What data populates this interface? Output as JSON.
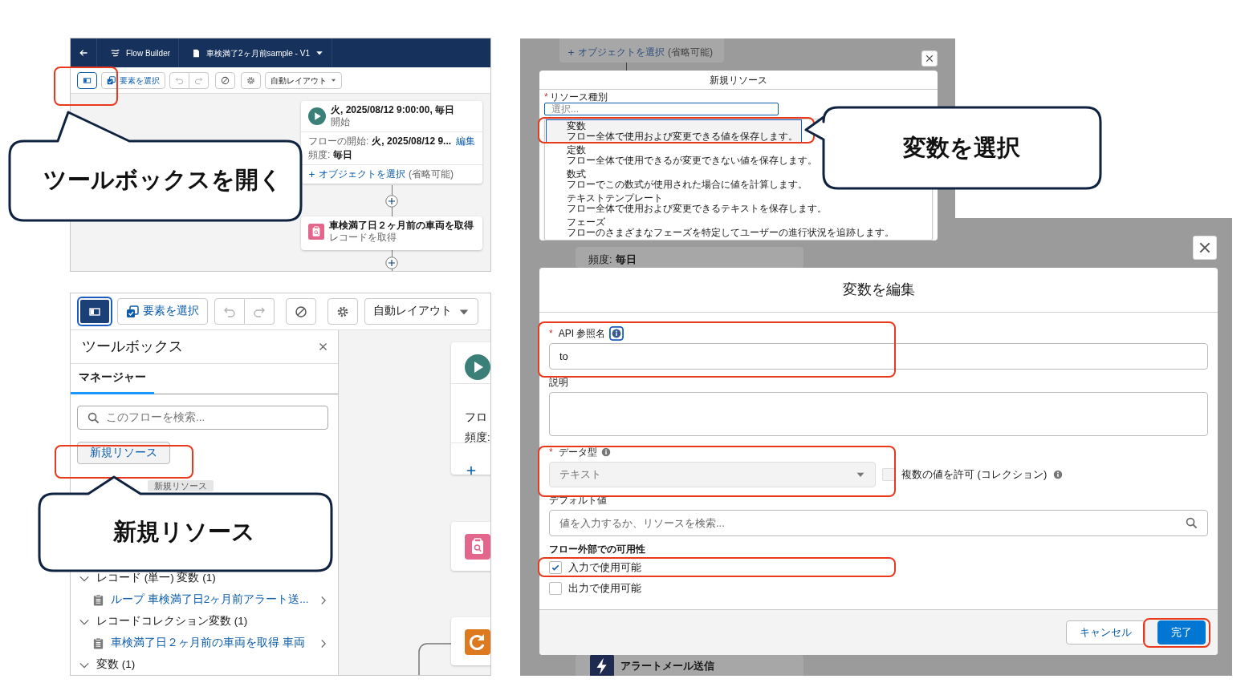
{
  "flow_builder_screen": {
    "header": {
      "app_name": "Flow Builder",
      "flow_title": "車検満了2ヶ月前sample - V1"
    },
    "toolbar": {
      "toolbox_open": false,
      "select_label": "要素を選択",
      "layout_label": "自動レイアウト"
    },
    "start_node": {
      "title": "火, 2025/08/12 9:00:00, 毎日",
      "subtitle": "開始",
      "start_label": "フローの開始:",
      "start_value": "火, 2025/08/12 9...",
      "edit_link": "編集",
      "frequency_label": "頻度:",
      "frequency_value": "毎日",
      "object_link": "オブジェクトを選択",
      "object_hint": "(省略可能)"
    },
    "get_records_node": {
      "title": "車検満了日２ヶ月前の車両を取得",
      "subtitle": "レコードを取得"
    }
  },
  "toolbox_screen": {
    "toolbar": {
      "toolbox_open": true,
      "select_label": "要素を選択",
      "layout_label": "自動レイアウト"
    },
    "toolbox": {
      "title": "ツールボックス",
      "tabs": [
        {
          "label": "マネージャー",
          "selected": true
        }
      ],
      "search_placeholder": "このフローを検索...",
      "new_resource_button": "新規リソース",
      "tooltip": "新規リソース",
      "tree": [
        {
          "label": "レコード (単一) 変数 (1)",
          "expanded": true,
          "children": [
            {
              "label": "ループ 車検満了日2ヶ月前アラート送..."
            }
          ]
        },
        {
          "label": "レコードコレクション変数 (1)",
          "expanded": true,
          "children": [
            {
              "label": "車検満了日２ヶ月前の車両を取得 車両"
            }
          ]
        },
        {
          "label": "変数 (1)",
          "expanded": true
        }
      ]
    },
    "canvas": {
      "start_node_text": "フロ",
      "frequency_label": "頻度:"
    }
  },
  "resource_type_screen": {
    "background": {
      "object_link": "オブジェクトを選択",
      "object_hint": "(省略可能)"
    },
    "modal": {
      "title": "新規リソース",
      "field_label": "リソース種別",
      "required_mark": "*",
      "placeholder": "選択...",
      "options": [
        {
          "label": "変数",
          "description": "フロー全体で使用および変更できる値を保存します。",
          "selected": true
        },
        {
          "label": "定数",
          "description": "フロー全体で使用できるが変更できない値を保存します。",
          "selected": false
        },
        {
          "label": "数式",
          "description": "フローでこの数式が使用された場合に値を計算します。",
          "selected": false
        },
        {
          "label": "テキストテンプレート",
          "description": "フロー全体で使用および変更できるテキストを保存します。",
          "selected": false
        },
        {
          "label": "フェーズ",
          "description": "フローのさまざまなフェーズを特定してユーザーの進行状況を追跡します。",
          "selected": false
        }
      ]
    }
  },
  "edit_variable_screen": {
    "background": {
      "frequency_label": "頻度:",
      "frequency_value": "毎日",
      "action_node": "アラートメール送信"
    },
    "modal": {
      "title": "変数を編集",
      "api_name": {
        "label": "API 参照名",
        "required_mark": "*",
        "value": "to"
      },
      "description": {
        "label": "説明"
      },
      "data_type": {
        "label": "データ型",
        "required_mark": "*",
        "value": "テキスト",
        "disabled": true
      },
      "allow_multiple": {
        "label": "複数の値を許可 (コレクション)",
        "checked": false
      },
      "default_value": {
        "label": "デフォルト値",
        "placeholder": "値を入力するか、リソースを検索..."
      },
      "availability": {
        "title": "フロー外部での可用性",
        "options": [
          {
            "label": "入力で使用可能",
            "checked": true
          },
          {
            "label": "出力で使用可能",
            "checked": false
          }
        ]
      },
      "buttons": [
        {
          "label": "キャンセル",
          "kind": "secondary"
        },
        {
          "label": "完了",
          "kind": "primary"
        }
      ]
    }
  },
  "callouts": [
    {
      "text": "ツールボックスを開く"
    },
    {
      "text": "新規リソース"
    },
    {
      "text": "変数を選択"
    }
  ]
}
